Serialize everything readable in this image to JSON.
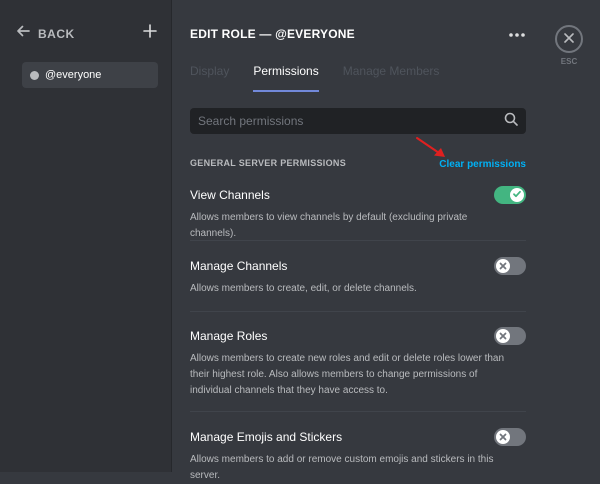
{
  "sidebar": {
    "back_label": "BACK",
    "back_icon": "arrow-left-icon",
    "add_icon": "plus-icon",
    "roles": [
      {
        "label": "@everyone",
        "dot_color": "#b9bbbe",
        "selected": true
      }
    ]
  },
  "header": {
    "title": "EDIT ROLE — @EVERYONE",
    "more_icon": "ellipsis-icon"
  },
  "tabs": [
    {
      "label": "Display",
      "active": false
    },
    {
      "label": "Permissions",
      "active": true
    },
    {
      "label": "Manage Members",
      "active": false
    }
  ],
  "search": {
    "placeholder": "Search permissions",
    "value": "",
    "icon": "magnifier-icon"
  },
  "section": {
    "title": "GENERAL SERVER PERMISSIONS",
    "clear_label": "Clear permissions"
  },
  "permissions": [
    {
      "name": "View Channels",
      "description": "Allows members to view channels by default (excluding private channels).",
      "enabled": true
    },
    {
      "name": "Manage Channels",
      "description": "Allows members to create, edit, or delete channels.",
      "enabled": false
    },
    {
      "name": "Manage Roles",
      "description": "Allows members to create new roles and edit or delete roles lower than their highest role. Also allows members to change permissions of individual channels that they have access to.",
      "enabled": false
    },
    {
      "name": "Manage Emojis and Stickers",
      "description": "Allows members to add or remove custom emojis and stickers in this server.",
      "enabled": false
    }
  ],
  "close": {
    "label": "ESC",
    "icon": "close-icon"
  },
  "colors": {
    "accent": "#7289da",
    "toggle_on": "#43b581",
    "toggle_off": "#72767d",
    "link": "#00b0f4",
    "annotation_arrow": "#e02020"
  }
}
